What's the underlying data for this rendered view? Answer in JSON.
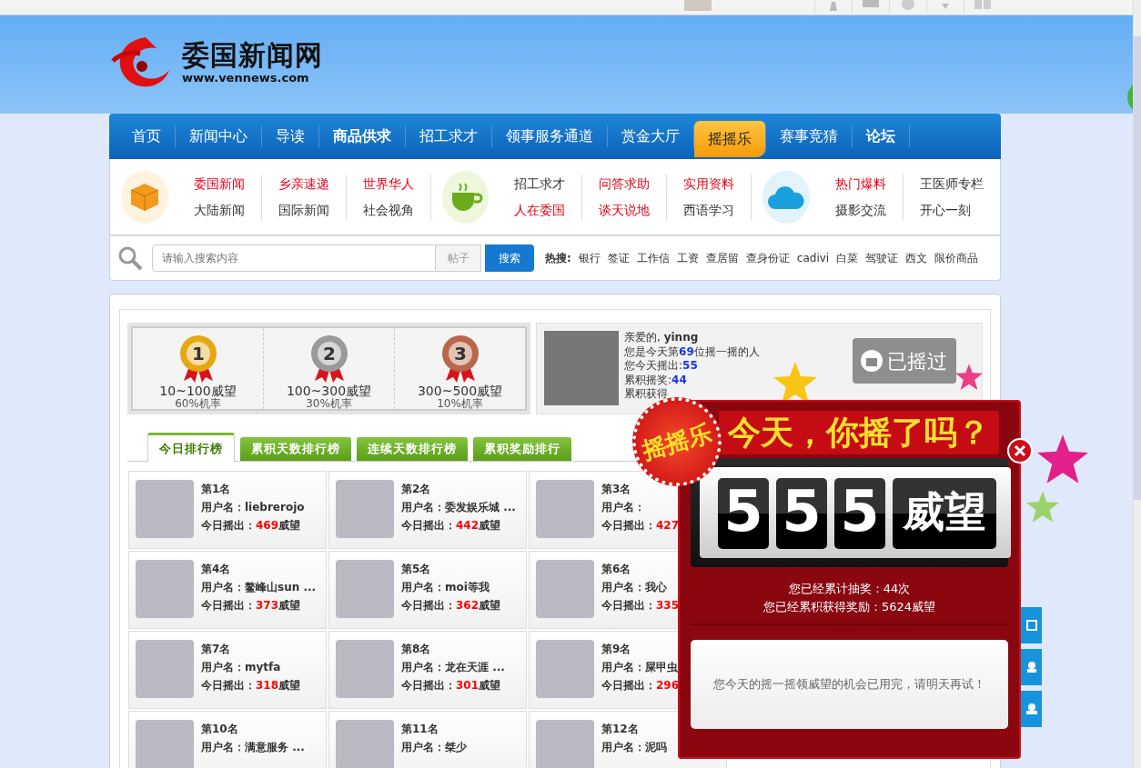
{
  "logo": {
    "name": "委国新闻网",
    "url": "www.vennews.com"
  },
  "nav": [
    {
      "label": "首页",
      "selected": false,
      "bold": false
    },
    {
      "label": "新闻中心",
      "selected": false,
      "bold": false
    },
    {
      "label": "导读",
      "selected": false,
      "bold": false
    },
    {
      "label": "商品供求",
      "selected": false,
      "bold": true
    },
    {
      "label": "招工求才",
      "selected": false,
      "bold": false
    },
    {
      "label": "领事服务通道",
      "selected": false,
      "bold": false
    },
    {
      "label": "赏金大厅",
      "selected": false,
      "bold": false
    },
    {
      "label": "摇摇乐",
      "selected": true,
      "bold": false
    },
    {
      "label": "赛事竞猜",
      "selected": false,
      "bold": false
    },
    {
      "label": "论坛",
      "selected": false,
      "bold": true
    }
  ],
  "subnav": [
    {
      "columns": [
        [
          {
            "label": "委国新闻",
            "hot": true
          },
          {
            "label": "大陆新闻",
            "hot": false
          }
        ],
        [
          {
            "label": "乡亲速递",
            "hot": true
          },
          {
            "label": "国际新闻",
            "hot": false
          }
        ],
        [
          {
            "label": "世界华人",
            "hot": true
          },
          {
            "label": "社会视角",
            "hot": false
          }
        ]
      ]
    },
    {
      "columns": [
        [
          {
            "label": "招工求才",
            "hot": false
          },
          {
            "label": "人在委国",
            "hot": true
          }
        ],
        [
          {
            "label": "问答求助",
            "hot": true
          },
          {
            "label": "谈天说地",
            "hot": true
          }
        ],
        [
          {
            "label": "实用资料",
            "hot": true
          },
          {
            "label": "西语学习",
            "hot": false
          }
        ]
      ]
    },
    {
      "columns": [
        [
          {
            "label": "热门爆料",
            "hot": true
          },
          {
            "label": "摄影交流",
            "hot": false
          }
        ],
        [
          {
            "label": "王医师专栏",
            "hot": false
          },
          {
            "label": "开心一刻",
            "hot": false
          }
        ]
      ]
    }
  ],
  "search": {
    "placeholder": "请输入搜索内容",
    "scope": "帖子",
    "button": "搜索",
    "hot_label": "热搜:",
    "hot": [
      "银行",
      "签证",
      "工作信",
      "工资",
      "查居留",
      "查身份证",
      "cadivi",
      "白菜",
      "驾驶证",
      "西文",
      "限价商品"
    ]
  },
  "rewards": [
    {
      "rank": "1",
      "range": "10~100威望",
      "chance": "60%机率",
      "color": "#e5a813"
    },
    {
      "rank": "2",
      "range": "100~300威望",
      "chance": "30%机率",
      "color": "#9a9a9a"
    },
    {
      "rank": "3",
      "range": "300~500威望",
      "chance": "10%机率",
      "color": "#b9674a"
    }
  ],
  "profile": {
    "greeting": "亲爱的, ",
    "user": "yinng",
    "lines": [
      {
        "before": "您是今天第",
        "num": "69",
        "after": "位摇一摇的人"
      },
      {
        "before": "您今天摇出:",
        "num": "55"
      },
      {
        "before": "累积摇奖:",
        "num": "44"
      },
      {
        "before": "累积获得"
      }
    ],
    "button": "已摇过"
  },
  "tabs": [
    {
      "label": "今日排行榜",
      "selected": true
    },
    {
      "label": "累积天数排行榜",
      "selected": false
    },
    {
      "label": "连续天数排行榜",
      "selected": false
    },
    {
      "label": "累积奖励排行",
      "selected": false
    }
  ],
  "rankings": [
    {
      "rank": "第1名",
      "user_label": "用户名：",
      "user": "liebrerojo",
      "score_label": "今日摇出：",
      "score": "469",
      "unit": "威望"
    },
    {
      "rank": "第2名",
      "user_label": "用户名：",
      "user": "委发娱乐城 ...",
      "score_label": "今日摇出：",
      "score": "442",
      "unit": "威望"
    },
    {
      "rank": "第3名",
      "user_label": "用户名：",
      "score_label": "今日摇出：",
      "score": "427"
    },
    {
      "rank": "第4名",
      "user_label": "用户名：",
      "user": "鳌峰山sun ...",
      "score_label": "今日摇出：",
      "score": "373",
      "unit": "威望"
    },
    {
      "rank": "第5名",
      "user_label": "用户名：",
      "user": "moi等我",
      "score_label": "今日摇出：",
      "score": "362",
      "unit": "威望"
    },
    {
      "rank": "第6名",
      "user_label": "用户名：",
      "user": "我心",
      "score_label": "今日摇出：",
      "score": "335"
    },
    {
      "rank": "第7名",
      "user_label": "用户名：",
      "user": "mytfa",
      "score_label": "今日摇出：",
      "score": "318",
      "unit": "威望"
    },
    {
      "rank": "第8名",
      "user_label": "用户名：",
      "user": "龙在天涯 ...",
      "score_label": "今日摇出：",
      "score": "301",
      "unit": "威望"
    },
    {
      "rank": "第9名",
      "user_label": "用户名：",
      "user": "屎甲虫",
      "score_label": "今日摇出：",
      "score": "296"
    },
    {
      "rank": "第10名",
      "user_label": "用户名：",
      "user": "满意服务 ..."
    },
    {
      "rank": "第11名",
      "user_label": "用户名：",
      "user": "桀少"
    },
    {
      "rank": "第12名",
      "user_label": "用户名：",
      "user": "泥吗"
    }
  ],
  "popup": {
    "badge": "摇摇乐",
    "banner": "今天，你摇了吗？",
    "digits": [
      "5",
      "5",
      "5"
    ],
    "unit": "威望",
    "stats": [
      "您已经累计抽奖：44次",
      "您已经累积获得奖励：5624威望"
    ],
    "message": "您今天的摇一摇领威望的机会已用完，请明天再试！"
  }
}
